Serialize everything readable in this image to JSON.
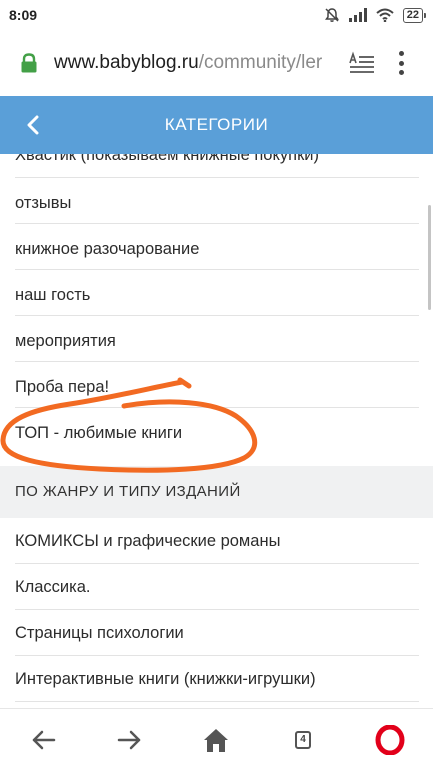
{
  "status_bar": {
    "time": "8:09",
    "battery": "22"
  },
  "browser": {
    "url_host": "www.babyblog.ru",
    "url_path": "/community/ler",
    "tab_count": "4"
  },
  "header": {
    "title": "КАТЕГОРИИ"
  },
  "list": {
    "items_top": [
      "Хвастик (показываем книжные покупки)",
      "отзывы",
      "книжное разочарование",
      "наш гость",
      "мероприятия",
      "Проба пера!",
      "ТОП - любимые книги"
    ],
    "section_title": "ПО ЖАНРУ И ТИПУ ИЗДАНИЙ",
    "items_bottom": [
      "КОМИКСЫ и графические романы",
      "Классика.",
      "Страницы психологии",
      "Интерактивные книги (книжки-игрушки)"
    ]
  },
  "colors": {
    "header_bg": "#5a9fd8",
    "annotation": "#f26a22",
    "lock": "#43a047",
    "opera": "#e2001a"
  },
  "icons": [
    "mute-icon",
    "signal-icon",
    "wifi-icon",
    "battery-icon",
    "lock-icon",
    "reader-mode-icon",
    "menu-icon",
    "back-arrow-icon",
    "back-nav-icon",
    "forward-nav-icon",
    "home-icon",
    "tabs-icon",
    "opera-icon"
  ]
}
